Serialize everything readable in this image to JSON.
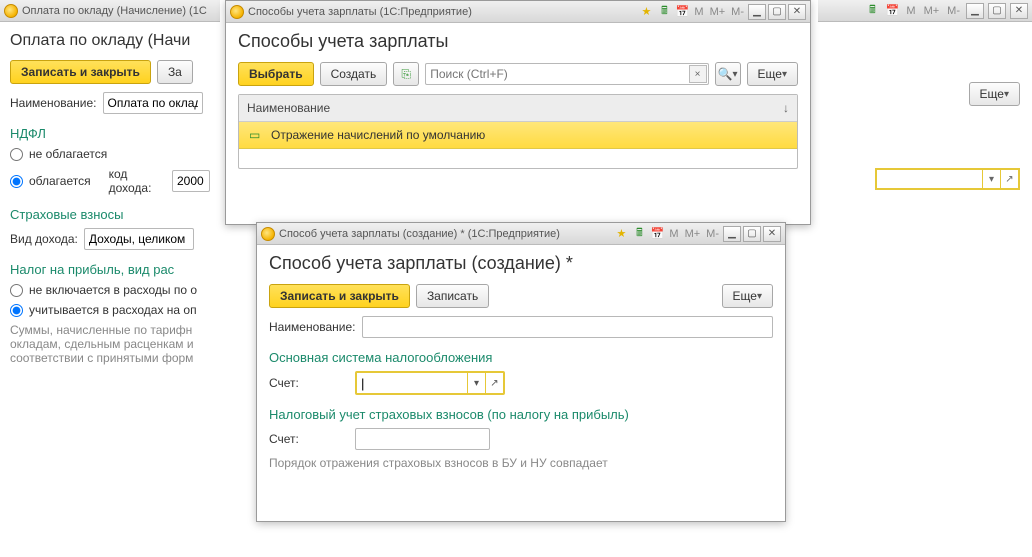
{
  "bg1": {
    "titlebar": "Оплата по окладу (Начисление) (1С",
    "heading": "Оплата по окладу (Начи",
    "save_close": "Записать и закрыть",
    "save_short": "За",
    "name_label": "Наименование:",
    "name_value": "Оплата по окладу",
    "ndfl_title": "НДФЛ",
    "ndfl_opt1": "не облагается",
    "ndfl_opt2": "облагается",
    "income_code_label": "код дохода:",
    "income_code_value": "2000",
    "insurance_title": "Страховые взносы",
    "income_type_label": "Вид дохода:",
    "income_type_value": "Доходы, целиком о",
    "profit_tax_title": "Налог на прибыль, вид рас",
    "profit_opt1": "не включается в расходы по о",
    "profit_opt2": "учитывается в расходах на оп",
    "hint_text": "Суммы, начисленные по тарифн окладам, сдельным расценкам и соответствии с принятыми форм"
  },
  "bg3": {
    "titlebar_icons": {
      "calc": "🖩",
      "cal": "📅"
    },
    "mem": [
      "M",
      "M+",
      "M-"
    ],
    "more": "Еще"
  },
  "list": {
    "titlebar": "Способы учета зарплаты  (1С:Предприятие)",
    "heading": "Способы учета зарплаты",
    "choose": "Выбрать",
    "create": "Создать",
    "search_placeholder": "Поиск (Ctrl+F)",
    "more": "Еще",
    "col_name": "Наименование",
    "row1": "Отражение начислений по умолчанию"
  },
  "create": {
    "titlebar": "Способ учета зарплаты (создание) *  (1С:Предприятие)",
    "heading": "Способ учета зарплаты (создание) *",
    "save_close": "Записать и закрыть",
    "save": "Записать",
    "more": "Еще",
    "name_label": "Наименование:",
    "section1": "Основная система налогообложения",
    "account_label": "Счет:",
    "section2": "Налоговый учет страховых взносов (по налогу на прибыль)",
    "account_label2": "Счет:",
    "footer_hint": "Порядок отражения страховых взносов в БУ и НУ совпадает"
  }
}
